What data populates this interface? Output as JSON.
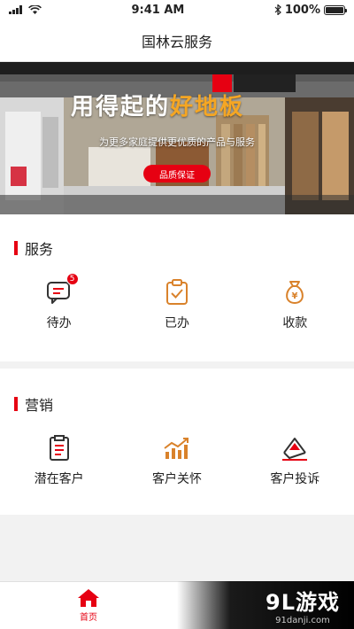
{
  "status_bar": {
    "time": "9:41 AM",
    "battery": "100%"
  },
  "header": {
    "title": "国林云服务"
  },
  "banner": {
    "headline_main": "用得起的",
    "headline_highlight": "好地板",
    "subtitle": "为更多家庭提供更优质的产品与服务",
    "badge": "品质保证"
  },
  "service": {
    "title": "服务",
    "items": [
      {
        "label": "待办",
        "icon": "todo-chat-icon",
        "badge": "5"
      },
      {
        "label": "已办",
        "icon": "clipboard-check-icon"
      },
      {
        "label": "收款",
        "icon": "money-bag-icon"
      }
    ]
  },
  "marketing": {
    "title": "营销",
    "items": [
      {
        "label": "潜在客户",
        "icon": "document-list-icon"
      },
      {
        "label": "客户关怀",
        "icon": "growth-chart-icon"
      },
      {
        "label": "客户投诉",
        "icon": "complaint-note-icon"
      }
    ]
  },
  "tab_bar": {
    "home_label": "首页"
  },
  "watermark": {
    "main": "9L游戏",
    "sub": "91danji.com"
  },
  "colors": {
    "accent": "#e60012",
    "icon_orange": "#d9822b",
    "icon_dark": "#333333"
  }
}
